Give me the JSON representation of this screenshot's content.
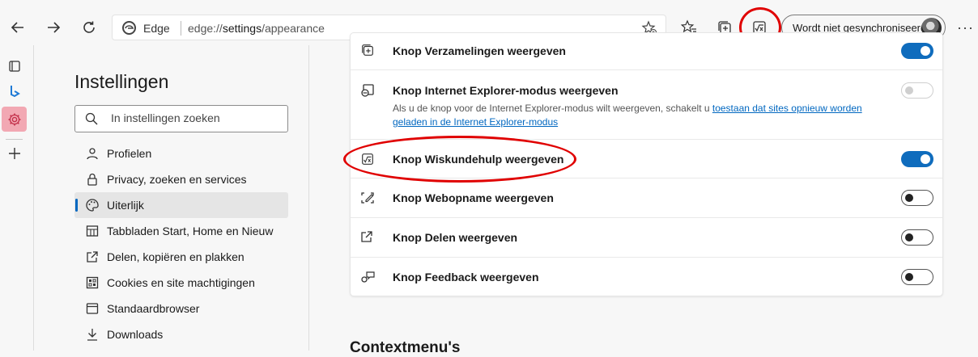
{
  "browser": {
    "address": {
      "site": "Edge",
      "url_scheme": "edge://",
      "url_host": "settings",
      "url_path": "/appearance"
    },
    "profile_label": "Wordt niet gesynchroniseerd",
    "highlight_color": "#e00000"
  },
  "nav": {
    "title": "Instellingen",
    "search_placeholder": "In instellingen zoeken",
    "items": [
      {
        "label": "Profielen",
        "icon": "person-icon"
      },
      {
        "label": "Privacy, zoeken en services",
        "icon": "lock-icon"
      },
      {
        "label": "Uiterlijk",
        "icon": "palette-icon",
        "selected": true
      },
      {
        "label": "Tabbladen Start, Home en Nieuw",
        "icon": "tab-grid-icon"
      },
      {
        "label": "Delen, kopiëren en plakken",
        "icon": "share-icon"
      },
      {
        "label": "Cookies en site machtigingen",
        "icon": "cookie-grid-icon"
      },
      {
        "label": "Standaardbrowser",
        "icon": "browser-icon"
      },
      {
        "label": "Downloads",
        "icon": "download-icon"
      }
    ],
    "accent": "#0067c0"
  },
  "settings": {
    "rows": [
      {
        "label": "Knop Verzamelingen weergeven",
        "state": "on"
      },
      {
        "label": "Knop Internet Explorer-modus weergeven",
        "state": "disabled",
        "desc_prefix": "Als u de knop voor de Internet Explorer-modus wilt weergeven, schakelt u ",
        "desc_link": "toestaan dat sites opnieuw worden geladen in de Internet Explorer-modus"
      },
      {
        "label": "Knop Wiskundehulp weergeven",
        "state": "on"
      },
      {
        "label": "Knop Webopname weergeven",
        "state": "off"
      },
      {
        "label": "Knop Delen weergeven",
        "state": "off"
      },
      {
        "label": "Knop Feedback weergeven",
        "state": "off"
      }
    ],
    "toggle_on_color": "#0f6cbd"
  },
  "next_section": "Contextmenu's"
}
